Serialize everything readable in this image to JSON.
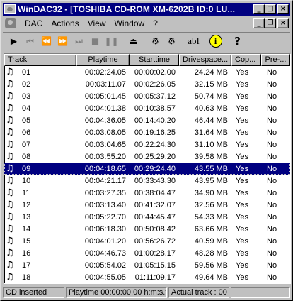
{
  "window": {
    "title": "WinDAC32 - [TOSHIBA  CD-ROM XM-6202B    ID:0   LU...",
    "controls": {
      "minimize": "_",
      "maximize": "□",
      "close": "×"
    }
  },
  "menu": {
    "items": [
      "DAC",
      "Actions",
      "View",
      "Window",
      "?"
    ],
    "mdi_controls": {
      "minimize": "_",
      "restore": "❐",
      "close": "×"
    }
  },
  "toolbar": {
    "buttons": [
      {
        "name": "play",
        "glyph": "▶",
        "enabled": true
      },
      {
        "name": "previous-track",
        "glyph": "⏮",
        "enabled": false
      },
      {
        "name": "rewind",
        "glyph": "⏪",
        "enabled": false
      },
      {
        "name": "fast-forward",
        "glyph": "⏩",
        "enabled": false
      },
      {
        "name": "next-track",
        "glyph": "⏭",
        "enabled": false
      },
      {
        "name": "stop",
        "glyph": "■",
        "enabled": false
      },
      {
        "name": "pause",
        "glyph": "❚❚",
        "enabled": false
      },
      {
        "name": "eject",
        "glyph": "⏏",
        "enabled": true
      },
      {
        "name": "copy-track",
        "glyph": "⚙",
        "enabled": true
      },
      {
        "name": "copy-range",
        "glyph": "⚙",
        "enabled": true
      },
      {
        "name": "rename",
        "glyph": "abI",
        "enabled": true
      },
      {
        "name": "info",
        "glyph": "i",
        "enabled": true
      },
      {
        "name": "help",
        "glyph": "?",
        "enabled": true
      }
    ]
  },
  "list": {
    "columns": [
      "Track",
      "Playtime",
      "Starttime",
      "Drivespace...",
      "Cop...",
      "Pre-..."
    ],
    "selected_index": 8,
    "rows": [
      {
        "track": "01",
        "playtime": "00:02:24.05",
        "starttime": "00:00:02.00",
        "drivespace": "24.24 MB",
        "copy": "Yes",
        "pre": "No"
      },
      {
        "track": "02",
        "playtime": "00:03:11.07",
        "starttime": "00:02:26.05",
        "drivespace": "32.15 MB",
        "copy": "Yes",
        "pre": "No"
      },
      {
        "track": "03",
        "playtime": "00:05:01.45",
        "starttime": "00:05:37.12",
        "drivespace": "50.74 MB",
        "copy": "Yes",
        "pre": "No"
      },
      {
        "track": "04",
        "playtime": "00:04:01.38",
        "starttime": "00:10:38.57",
        "drivespace": "40.63 MB",
        "copy": "Yes",
        "pre": "No"
      },
      {
        "track": "05",
        "playtime": "00:04:36.05",
        "starttime": "00:14:40.20",
        "drivespace": "46.44 MB",
        "copy": "Yes",
        "pre": "No"
      },
      {
        "track": "06",
        "playtime": "00:03:08.05",
        "starttime": "00:19:16.25",
        "drivespace": "31.64 MB",
        "copy": "Yes",
        "pre": "No"
      },
      {
        "track": "07",
        "playtime": "00:03:04.65",
        "starttime": "00:22:24.30",
        "drivespace": "31.10 MB",
        "copy": "Yes",
        "pre": "No"
      },
      {
        "track": "08",
        "playtime": "00:03:55.20",
        "starttime": "00:25:29.20",
        "drivespace": "39.58 MB",
        "copy": "Yes",
        "pre": "No"
      },
      {
        "track": "09",
        "playtime": "00:04:18.65",
        "starttime": "00:29:24.40",
        "drivespace": "43.55 MB",
        "copy": "Yes",
        "pre": "No"
      },
      {
        "track": "10",
        "playtime": "00:04:21.17",
        "starttime": "00:33:43.30",
        "drivespace": "43.95 MB",
        "copy": "Yes",
        "pre": "No"
      },
      {
        "track": "11",
        "playtime": "00:03:27.35",
        "starttime": "00:38:04.47",
        "drivespace": "34.90 MB",
        "copy": "Yes",
        "pre": "No"
      },
      {
        "track": "12",
        "playtime": "00:03:13.40",
        "starttime": "00:41:32.07",
        "drivespace": "32.56 MB",
        "copy": "Yes",
        "pre": "No"
      },
      {
        "track": "13",
        "playtime": "00:05:22.70",
        "starttime": "00:44:45.47",
        "drivespace": "54.33 MB",
        "copy": "Yes",
        "pre": "No"
      },
      {
        "track": "14",
        "playtime": "00:06:18.30",
        "starttime": "00:50:08.42",
        "drivespace": "63.66 MB",
        "copy": "Yes",
        "pre": "No"
      },
      {
        "track": "15",
        "playtime": "00:04:01.20",
        "starttime": "00:56:26.72",
        "drivespace": "40.59 MB",
        "copy": "Yes",
        "pre": "No"
      },
      {
        "track": "16",
        "playtime": "00:04:46.73",
        "starttime": "01:00:28.17",
        "drivespace": "48.28 MB",
        "copy": "Yes",
        "pre": "No"
      },
      {
        "track": "17",
        "playtime": "00:05:54.02",
        "starttime": "01:05:15.15",
        "drivespace": "59.56 MB",
        "copy": "Yes",
        "pre": "No"
      },
      {
        "track": "18",
        "playtime": "00:04:55.05",
        "starttime": "01:11:09.17",
        "drivespace": "49.64 MB",
        "copy": "Yes",
        "pre": "No"
      }
    ],
    "track_icon": "♫"
  },
  "status": {
    "disc": "CD inserted",
    "playtime": "Playtime 00:00:00.00 h:m:s.f",
    "track": "Actual track : 00",
    "extra": ""
  },
  "colors": {
    "selection": "#000080",
    "titlebar": "#000080",
    "face": "#c0c0c0"
  }
}
